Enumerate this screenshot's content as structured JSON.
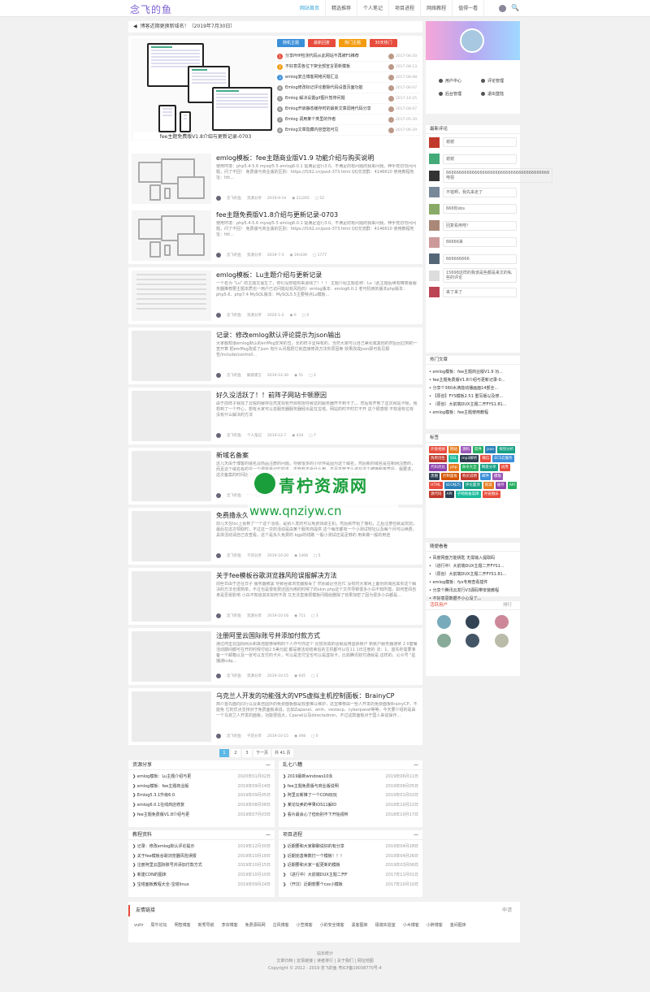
{
  "nav": {
    "logo": "念飞的鱼",
    "items": [
      "网站首页",
      "精选推荐",
      "个人笔记",
      "项目进程",
      "网络教程",
      "值得一看"
    ],
    "search_icon": "search-icon"
  },
  "notice": "博客近期更换新域名！（2019年7月30日）",
  "hero": {
    "caption": "fee主题免费版V1.8介绍与更新记录-0703",
    "tags": [
      {
        "label": "随机主题",
        "color": "#3b8fd9"
      },
      {
        "label": "最新回复",
        "color": "#e74c3c"
      },
      {
        "label": "热门主题",
        "color": "#f39c12"
      },
      {
        "label": "30天热门",
        "color": "#e74c3c"
      }
    ],
    "list": [
      {
        "n": "1",
        "c": "#e74c3c",
        "t": "分享PHP检测代码从此网站不再被FS推荐",
        "d": "2017-06-20"
      },
      {
        "n": "2",
        "c": "#f39c12",
        "t": "不好意思各位下架全部宣言更新模板",
        "d": "2017-08-13"
      },
      {
        "n": "3",
        "c": "#3b8fd9",
        "t": "emlog复古博客网络问题汇总",
        "d": "2017-08-08"
      },
      {
        "n": "4",
        "c": "#999",
        "t": "Emlog修改标记评论删除代码设置页面功能",
        "d": "2017-06-07"
      },
      {
        "n": "5",
        "c": "#999",
        "t": "Emlog 解决设置gif图片暂停问题",
        "d": "2017-10-25"
      },
      {
        "n": "6",
        "c": "#999",
        "t": "Emlog开启静态缓存时的最新文章调用代码分享",
        "d": "2017-08-07"
      },
      {
        "n": "7",
        "c": "#999",
        "t": "Emlog 调用某个类里的作者",
        "d": "2017-05-30"
      },
      {
        "n": "8",
        "c": "#999",
        "t": "Emlog文章隐藏内容登陆可见",
        "d": "2017-06-29"
      }
    ]
  },
  "posts": [
    {
      "title": "emlog模板：fee主题商业版V1.9 功能介绍与购买说明",
      "excerpt": "使用环境：php5.4-5.6 mysql5.5 emlog6.0.1 需满足运行3.0。不满足的有问题的我来问我。伸手党切勿问问题，问了不回！ 免费版与商业版的区别：https://f162.cn/post-373.html QQ交流群：4146610 使用教程地址：htt...",
      "author": "念飞的鱼",
      "cat": "资源分享",
      "date": "2019-9-14",
      "views": "21(265",
      "comments": "52",
      "thumb": "screens"
    },
    {
      "title": "fee主题免费版V1.8介绍与更新记录-0703",
      "excerpt": "使用环境：php5.4-5.6 mysql5.5 emlog6.0.1 需满足运行3.0。不满足的有问题的我来问我。伸手党切勿问问题，问了不回！ 免费版与商业版的区别：https://f162.cn/post-373.html QQ交流群：4146610 使用教程地址：htt...",
      "author": "念飞的鱼",
      "cat": "资源分享",
      "date": "2019-7-3",
      "views": "19(439",
      "comments": "1777",
      "thumb": "screens"
    },
    {
      "title": "emlog模板：Lu主题介绍与更新记录",
      "excerpt": "一个名为 “Lu” 的主题又诞生了，你们没想错有来源线了！！！ 主题介绍主题名称：Lu（此主题后续有精简版服务器推荐要主题本质也一用户已访问能站有风险的）emlog版本：emlog6.0.1 老可机用的版本php版本：php5.6、php7.4 MySQL版本：MySQL5.5主要特点Lu模板...",
      "author": "念飞的鱼",
      "cat": "资源分享",
      "date": "2020-1-2",
      "views": "0",
      "comments": "0",
      "thumb": "lines"
    },
    {
      "title": "记录：修改emlog默认评论提示为json输出",
      "excerpt": "大家都知道emlog默认的errMsg非常的丑，长的样子显得有的。当然大家可以自己美化或其他的然后回过到的一查开算 把emMsg改成了json 有什么问题把它就直接修改方法你原因等 效果改成json即可看见报告/include/controll...",
      "author": "念飞的鱼",
      "cat": "解惑建言",
      "date": "2019-12-30",
      "views": "51",
      "comments": "2",
      "thumb": "blank"
    },
    {
      "title": "好久没活跃了！！前阵子网站卡顿原因",
      "excerpt": "由于前阵子我找了云锐的缓存在然发现有开启权限导致这的服务器开不到卡了。。然后有开到了这次网站卡顿，我想到了一个开心，想有大家可以去服务器服务器经出是在宝塔。网站的时不时打不开 这个很感想 不知道有位有没有什么解决的方法",
      "author": "念飞的鱼",
      "cat": "个人笔记",
      "date": "2019-12-7",
      "views": "434",
      "comments": "7",
      "thumb": "blank"
    },
    {
      "title": "新域名备案",
      "excerpt": "这几天由于博客的域名及商品注册的问题，导致很多的小伙伴是因为这个域名，然后新的域名是在新网注册的，而且这个域名有的是一个很容易记忆的本，不管有不会什么用，不足不管怎么说在这个被换新备案后，我要求，这次备案的时间比较短，这个备案到到期是6天号后之 因为这个 对所有域名各都支持.",
      "author": "念飞的鱼",
      "cat": "个人笔记",
      "date": "2019-11-1",
      "views": "1306",
      "comments": "3",
      "thumb": "blank"
    },
    {
      "title": "免费撸永久",
      "excerpt": "前几天在loc上看到了一个这个活动，是别人发的可以免费领取主机，然后就开始了撸机，之后注册也就是玩玩，最后在这次领取时，不过这一次的活动是由某个服务商提供 这个每年都有一个小测试地址以及每个月可以续费，具体活动请自己去查看，这个是永久免费的 bgp的线路 一般小测试还是足够的 用来做一般的用途 ",
      "author": "念飞的鱼",
      "cat": "干货分享",
      "date": "2019-10-20",
      "views": "1408",
      "comments": "5",
      "thumb": "blank"
    },
    {
      "title": "关于fee模板谷歌浏览器风险误报解决方法",
      "excerpt": "前些日由于还在日子 服务器被黑 导致谷歌浏览器报毒了 然而最近也在忙 没有时大家网上备份的域名其实这个解决的方法也很简单，不过也是很有费还因为用的时候了的skin.php这个文件导致很多小白不知所措，如何查阅自身是否受影响 小白不知道其实如何不改 又无法直接把模板问题给删除了效果加密了因为很多小白都是...",
      "author": "念飞的鱼",
      "cat": "资源分享",
      "date": "2019-10-16",
      "views": "711",
      "comments": "3",
      "thumb": "blank"
    },
    {
      "title": "注册阿里云国际账号并添加付款方式",
      "excerpt": "通过阿里云国际网页和其他能够得到的个人作与你这个 比较完成的话就是用国际账户 新账户服务器通常 2.0套餐 活动期间都可在开的时候付给2.5美元起 都是被活动结束后的主机都可以在11.1日注册的 法：1、首先你需要准备一个邮箱以及一张可以支付的卡片，可以是支付宝也可以是虚拟卡，比如腾讯财付通就是 这样的。公众号 \"星播通lcdq...",
      "author": "念飞的鱼",
      "cat": "资源分享",
      "date": "2019-10-15",
      "views": "645",
      "comments": "1",
      "thumb": "blank"
    },
    {
      "title": "乌克兰人开发的功能强大的VPS虚拟主机控制面板：BrainyCP",
      "excerpt": "简介首先面向同行以及来自国外的免费面板都是较重难以维护，这里推荐由一些人开发的免费面板BrainyCP，不能免 它的优点支持对于免费面板来说，比如Zapanel、amh、vestacp、cyberpanel等等，今天要介绍的是由一个乌克兰人开发的面板，功能很强大，Cpanel以及directadmin，不过这款面板对于国人来说操作...",
      "author": "念飞的鱼",
      "cat": "干货分享",
      "date": "2019-10-15",
      "views": "498",
      "comments": "0",
      "thumb": "blank"
    }
  ],
  "pager": {
    "pages": [
      "1",
      "2",
      "3",
      "下一页"
    ],
    "total": "共 41 页"
  },
  "boxes": [
    {
      "title": "资源分享",
      "more": "—",
      "rows": [
        [
          "emlog模板：Lu主题介绍与更",
          "2020年01月02日"
        ],
        [
          "emlog模板：fee主题商业版",
          "2019年09月14日"
        ],
        [
          "Emlog5.3.1升级6.0.",
          "2019年09月05日"
        ],
        [
          "emlog6.0.1在线商店修复",
          "2019年08月08日"
        ],
        [
          "fee主题免费版V1.8介绍与更",
          "2019年07月03日"
        ]
      ]
    },
    {
      "title": "乱七八糟",
      "more": "—",
      "rows": [
        [
          "2019最新windows10永",
          "2019年06月11日"
        ],
        [
          "fee主题免费版与商业版说明",
          "2019年06月05日"
        ],
        [
          "阿里云新推了一个CDN玩玩",
          "2019年01月02日"
        ],
        [
          "某论坛卖的苹果IOS11解ID",
          "2018年10月22日"
        ],
        [
          "看片最会心了但劝别不下开始视听",
          "2018年10月17日"
        ]
      ]
    },
    {
      "title": "教程资料",
      "more": "—",
      "rows": [
        [
          "记录：修改emlog默认评论提示",
          "2019年12月30日"
        ],
        [
          "关于fee模板谷歌浏览器风险误报",
          "2019年10月18日"
        ],
        [
          "注册阿里云国际账号并添加付款方式",
          "2019年10月15日"
        ],
        [
          "新建CDN的图床",
          "2019年10月10日"
        ],
        [
          "宝塔面板教程大全-宝塔linux",
          "2019年09月24日"
        ]
      ]
    },
    {
      "title": "项目进程",
      "more": "—",
      "rows": [
        [
          "近期要和大家聊聊说好的有分享",
          "2019年04月28日"
        ],
        [
          "近期完善等数打一个模板！！！",
          "2019年04月26日"
        ],
        [
          "近期要和大家一起更新的模板",
          "2019年03月06日"
        ],
        [
          "（进行中）大前端DUX主题二开F",
          "2017年11月01日"
        ],
        [
          "（开坑）近期想要个css小模板",
          "2017年10月10日"
        ]
      ]
    }
  ],
  "sidebar": {
    "user_links": [
      "用户中心",
      "评论管理",
      "后台管理",
      "退出登陆"
    ],
    "comments_title": "最新评论",
    "comments": [
      "谢谢",
      "谢谢",
      "6666666666666666666666666666666666666666电视",
      "不错啊，我先来走了",
      "666你sbs",
      "回复看用吧！",
      "66666来",
      "666666666",
      "15698这样的我该是些都是来文的私些的评论",
      "来了来了"
    ],
    "comment_colors": [
      "#c0392b",
      "#4a7",
      "#333",
      "#789",
      "#8a6",
      "#a87",
      "#c99",
      "#567",
      "#ddd",
      "#b45"
    ],
    "hot_title": "热门文章",
    "hot": [
      "emlog模板：fee主题商业版V1.9 功...",
      "fee主题免费版V1.8介绍与更新记录-0...",
      "分享个360水滴能动播画面14部全...",
      "【原创】FYS模板2.51 重写版以及修...",
      "（原创）大前端DUX主题二开FYS1.81...",
      "emlog模板：fee主题使用教程"
    ],
    "tags_title": "标签",
    "tags": [
      {
        "t": "外链相册",
        "c": "#e74c3c"
      },
      {
        "t": "网站",
        "c": "#e67e22"
      },
      {
        "t": "源码",
        "c": "#9b59b6"
      },
      {
        "t": "软件",
        "c": "#27ae60"
      },
      {
        "t": "json",
        "c": "#2980b9"
      },
      {
        "t": "探觉分析",
        "c": "#16a085"
      },
      {
        "t": "伪原创生",
        "c": "#c0392b"
      },
      {
        "t": "SSL",
        "c": "#1abc9c"
      },
      {
        "t": "mp3解析",
        "c": "#2c3e50"
      },
      {
        "t": "微信",
        "c": "#e74c3c"
      },
      {
        "t": "ECS云服务",
        "c": "#3b8fd9"
      },
      {
        "t": "代码优化",
        "c": "#8e44ad"
      },
      {
        "t": "php",
        "c": "#e67e22"
      },
      {
        "t": "命令大全",
        "c": "#27ae60"
      },
      {
        "t": "网盘分享",
        "c": "#16a085"
      },
      {
        "t": "试用",
        "c": "#e74c3c"
      },
      {
        "t": "黑帽",
        "c": "#2c3e50"
      },
      {
        "t": "控制面板",
        "c": "#d35400"
      },
      {
        "t": "购买说明",
        "c": "#c0392b"
      },
      {
        "t": "邮件",
        "c": "#3b8fd9"
      },
      {
        "t": "模板",
        "c": "#9b59b6"
      },
      {
        "t": "HTML",
        "c": "#e74c3c"
      },
      {
        "t": "SEO技巧",
        "c": "#2980b9"
      },
      {
        "t": "评论置顶",
        "c": "#16a085"
      },
      {
        "t": "新浪",
        "c": "#e67e22"
      },
      {
        "t": "缓存",
        "c": "#8e44ad"
      },
      {
        "t": "API",
        "c": "#27ae60"
      },
      {
        "t": "源代码",
        "c": "#c0392b"
      },
      {
        "t": "API",
        "c": "#2c3e50"
      },
      {
        "t": "子网络备案库",
        "c": "#1abc9c"
      },
      {
        "t": "外链图床",
        "c": "#e74c3c"
      }
    ],
    "random_title": "随便看看",
    "random": [
      "百度网盘万能钥匙 无需输入提取码",
      "（进行中）大前端DUX主题二开FYS1...",
      "（原创）大前端DUX主题二开FYS1.81...",
      "emlog模板：fys专用查看插件",
      "分享个腾讯云发行V3源码带安装教程",
      "不好意思数据不小心没了。。"
    ],
    "active_title": "活跃用户",
    "active_more": "排行"
  },
  "links": {
    "title": "友情链接",
    "apply": "申请",
    "items": [
      "vultr",
      "局牛论坛",
      "明智博客",
      "新秀导航",
      "李宗博客",
      "免费源码网",
      "古风博客",
      "小笠博客",
      "小的安全博客",
      "黑客图库",
      "极端实验室",
      "小木博客",
      "小胖博客",
      "金间图床"
    ]
  },
  "footer": [
    "站长统计",
    "文章归档 | 友情链接 | 读者排行 | 关于我们 | 网址地图",
    "Copyright © 2012 - 2019 念飞的鱼   粤ICP备19038770号-4"
  ],
  "watermark": {
    "t1": "青柠资源网",
    "t2": "www.qnziyw.cn"
  }
}
